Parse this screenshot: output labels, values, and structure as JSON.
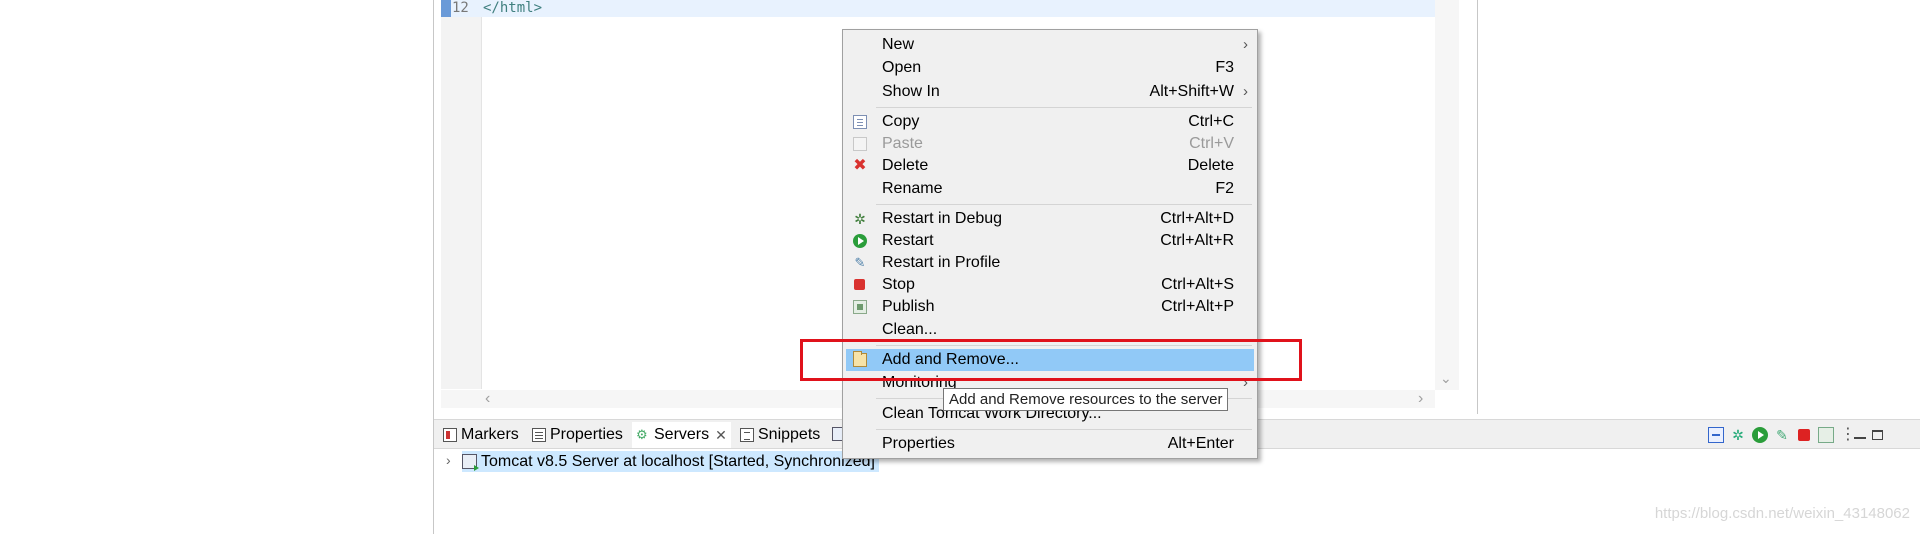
{
  "editor": {
    "line_number": "12",
    "line_code": "</html>"
  },
  "context_menu": {
    "items": [
      {
        "label": "New",
        "shortcut": "",
        "submenu": true,
        "icon": "none"
      },
      {
        "label": "Open",
        "shortcut": "F3",
        "submenu": false,
        "icon": "none"
      },
      {
        "label": "Show In",
        "shortcut": "Alt+Shift+W",
        "submenu": true,
        "icon": "none"
      },
      {
        "label": "Copy",
        "shortcut": "Ctrl+C",
        "submenu": false,
        "icon": "copy-icon"
      },
      {
        "label": "Paste",
        "shortcut": "Ctrl+V",
        "submenu": false,
        "icon": "paste-icon",
        "disabled": true
      },
      {
        "label": "Delete",
        "shortcut": "Delete",
        "submenu": false,
        "icon": "delete-icon"
      },
      {
        "label": "Rename",
        "shortcut": "F2",
        "submenu": false,
        "icon": "none"
      },
      {
        "label": "Restart in Debug",
        "shortcut": "Ctrl+Alt+D",
        "submenu": false,
        "icon": "debug-icon"
      },
      {
        "label": "Restart",
        "shortcut": "Ctrl+Alt+R",
        "submenu": false,
        "icon": "restart-icon"
      },
      {
        "label": "Restart in Profile",
        "shortcut": "",
        "submenu": false,
        "icon": "profile-icon"
      },
      {
        "label": "Stop",
        "shortcut": "Ctrl+Alt+S",
        "submenu": false,
        "icon": "stop-icon"
      },
      {
        "label": "Publish",
        "shortcut": "Ctrl+Alt+P",
        "submenu": false,
        "icon": "publish-icon"
      },
      {
        "label": "Clean...",
        "shortcut": "",
        "submenu": false,
        "icon": "none"
      },
      {
        "label": "Add and Remove...",
        "shortcut": "",
        "submenu": false,
        "icon": "add-remove-icon",
        "highlighted": true
      },
      {
        "label": "Monitoring",
        "shortcut": "",
        "submenu": true,
        "icon": "none"
      },
      {
        "label": "Clean Tomcat Work Directory...",
        "shortcut": "",
        "submenu": false,
        "icon": "none"
      },
      {
        "label": "Properties",
        "shortcut": "Alt+Enter",
        "submenu": false,
        "icon": "none"
      }
    ],
    "submenu_glyph": "›"
  },
  "tooltip": {
    "text": "Add and Remove resources to the server"
  },
  "view": {
    "tabs": [
      {
        "label": "Markers",
        "icon": "markers-icon",
        "active": false
      },
      {
        "label": "Properties",
        "icon": "properties-icon",
        "active": false
      },
      {
        "label": "Servers",
        "icon": "servers-icon",
        "active": true
      },
      {
        "label": "Snippets",
        "icon": "snippets-icon",
        "active": false
      }
    ],
    "close_glyph": "✕"
  },
  "servers": {
    "entry": "Tomcat v8.5 Server at localhost  [Started, Synchronized]"
  },
  "watermark": "https://blog.csdn.net/weixin_43148062",
  "colors": {
    "menu_highlight": "#91c9f7",
    "emphasis_box": "#e0121b",
    "selection": "#cde8ff"
  }
}
